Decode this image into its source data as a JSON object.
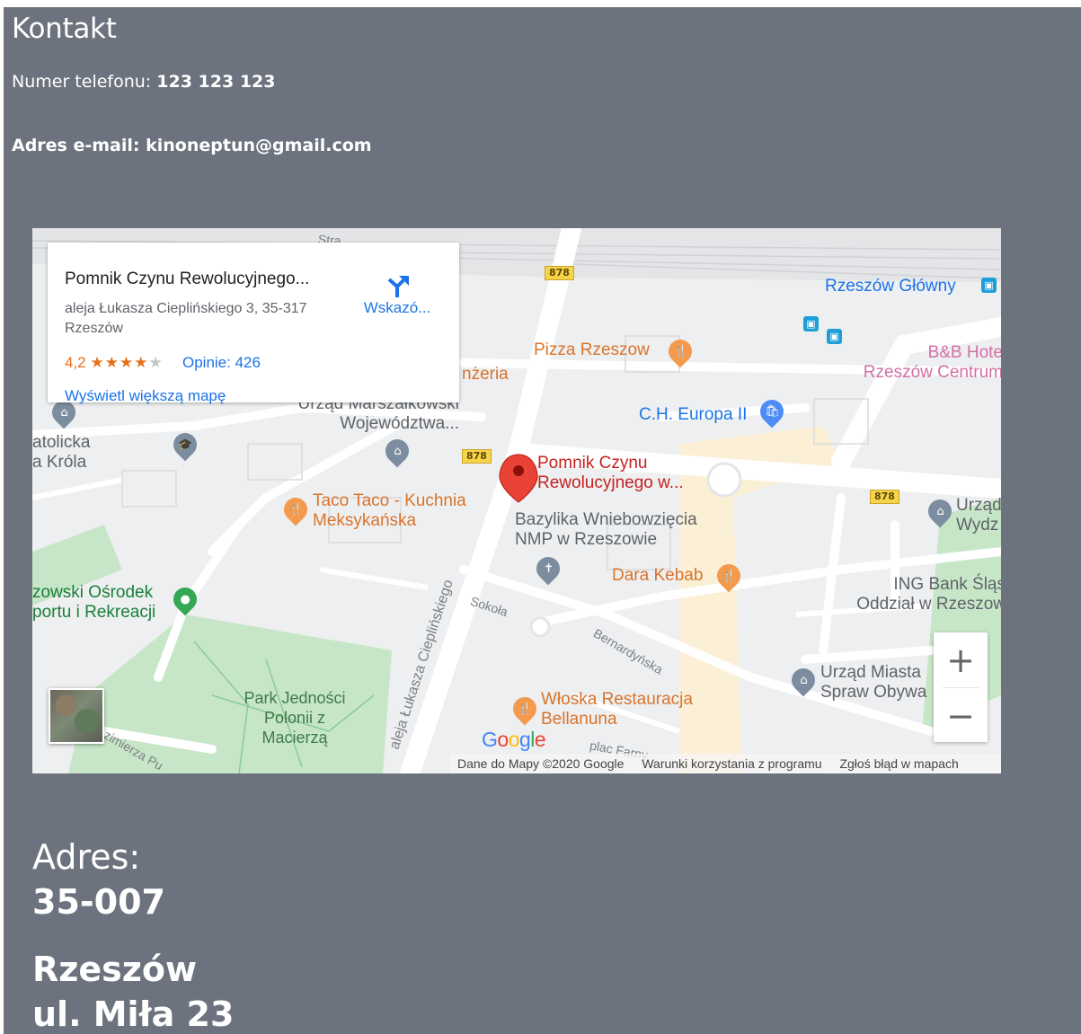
{
  "contact": {
    "title": "Kontakt",
    "phone_label": "Numer telefonu:",
    "phone_value": "123 123 123",
    "email_line": "Adres e-mail: kinoneptun@gmail.com"
  },
  "map": {
    "place_card": {
      "name": "Pomnik Czynu Rewolucyjnego...",
      "address": "aleja Łukasza Cieplińskiego 3, 35-317 Rzeszów",
      "rating": "4,2",
      "reviews": "Opinie: 426",
      "directions_label": "Wskazó...",
      "bigger_map": "Wyświetl większą mapę"
    },
    "labels": {
      "marker": "Pomnik Czynu Rewolucyjnego w...",
      "rzeszow_glowny": "Rzeszów Główny",
      "pizza": "Pizza Rzeszow",
      "bb_hotel": "B&B Hote Rzeszów Centrum",
      "europa": "C.H. Europa II",
      "taco": "Taco Taco - Kuchnia Meksykańska",
      "bazylika": "Bazylika Wniebowzięcia NMP w Rzeszowie",
      "dara": "Dara Kebab",
      "urzad_wydz": "Urząd Wydz",
      "ing": "ING Bank Śląs Oddział w Rzeszow",
      "osrodek": "zowski Ośrodek portu i Rekreacji",
      "park": "Park Jedności Polonii z Macierzą",
      "wloska": "Włoska Restauracja Bellanuna",
      "urzad_miasta": "Urząd Miasta Spraw Obywa",
      "urzad_marsz": "Urząd Marszałkowski Województwa...",
      "katolicka": "atolicka a Króla",
      "kawiarnia": "nżeria",
      "street_cieplinskiego": "aleja Łukasza Cieplińskiego",
      "street_sokola": "Sokoła",
      "street_bernardynska": "Bernardyńska",
      "street_plac": "plac Farny",
      "street_kazimierza": "zimierza Pu",
      "street_stra": "Stra",
      "road_878": "878"
    },
    "attribution": {
      "data": "Dane do Mapy ©2020 Google",
      "terms": "Warunki korzystania z programu",
      "report": "Zgłoś błąd w mapach"
    },
    "google": "Google",
    "zoom_in": "+",
    "zoom_out": "−"
  },
  "address": {
    "label": "Adres:",
    "zip": "35-007",
    "city": "Rzeszów",
    "street": "ul. Miła 23"
  }
}
